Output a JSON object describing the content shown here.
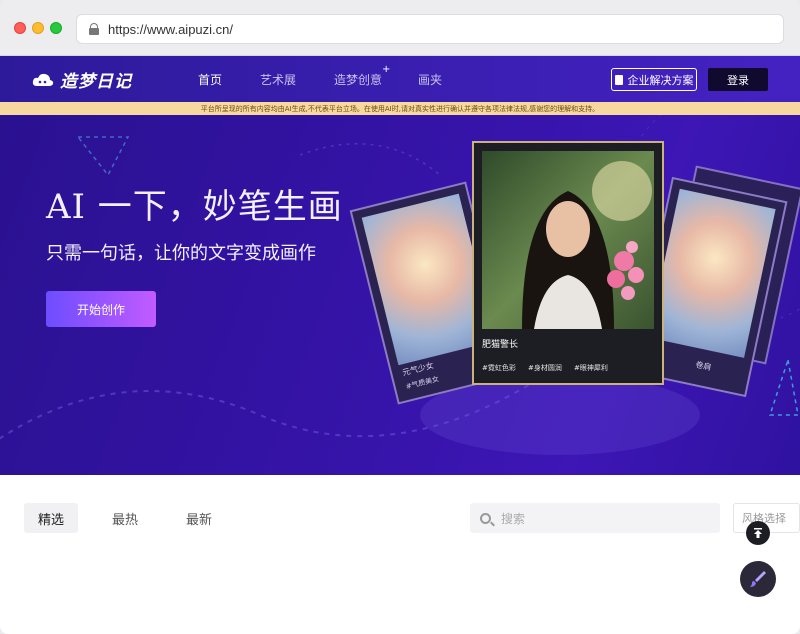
{
  "browser": {
    "url": "https://www.aipuzi.cn/"
  },
  "nav": {
    "logo": "造梦日记",
    "items": [
      {
        "label": "首页"
      },
      {
        "label": "艺术展"
      },
      {
        "label": "造梦创意"
      },
      {
        "label": "画夹"
      }
    ],
    "plus_badge": "+",
    "enterprise_label": "企业解决方案",
    "login_label": "登录"
  },
  "notice": "平台所呈现的所有内容均由AI生成,不代表平台立场。在使用AI时,请对真实性进行确认并遵守各项法律法规,感谢您的理解和支持。",
  "hero": {
    "title": "AI 一下，妙笔生画",
    "subtitle": "只需一句话，让你的文字变成画作",
    "cta_label": "开始创作",
    "center_card": {
      "title": "肥猫警长",
      "tags": [
        "#霓虹色彩",
        "#身材圆润",
        "#眼神犀利"
      ]
    },
    "left_card": {
      "label1": "元气少女",
      "label2": "#气质美女"
    },
    "right_card": {
      "label": "卷肩"
    }
  },
  "content": {
    "tabs": [
      {
        "label": "精选"
      },
      {
        "label": "最热"
      },
      {
        "label": "最新"
      }
    ],
    "search_placeholder": "搜索",
    "style_select": "风格选择"
  },
  "colors": {
    "hero_bg": "#3413a6",
    "nav_bg": "#3b1fb3",
    "notice_bg": "#f7d9a0",
    "cta_start": "#6d4dff",
    "cta_end": "#c25bff"
  }
}
